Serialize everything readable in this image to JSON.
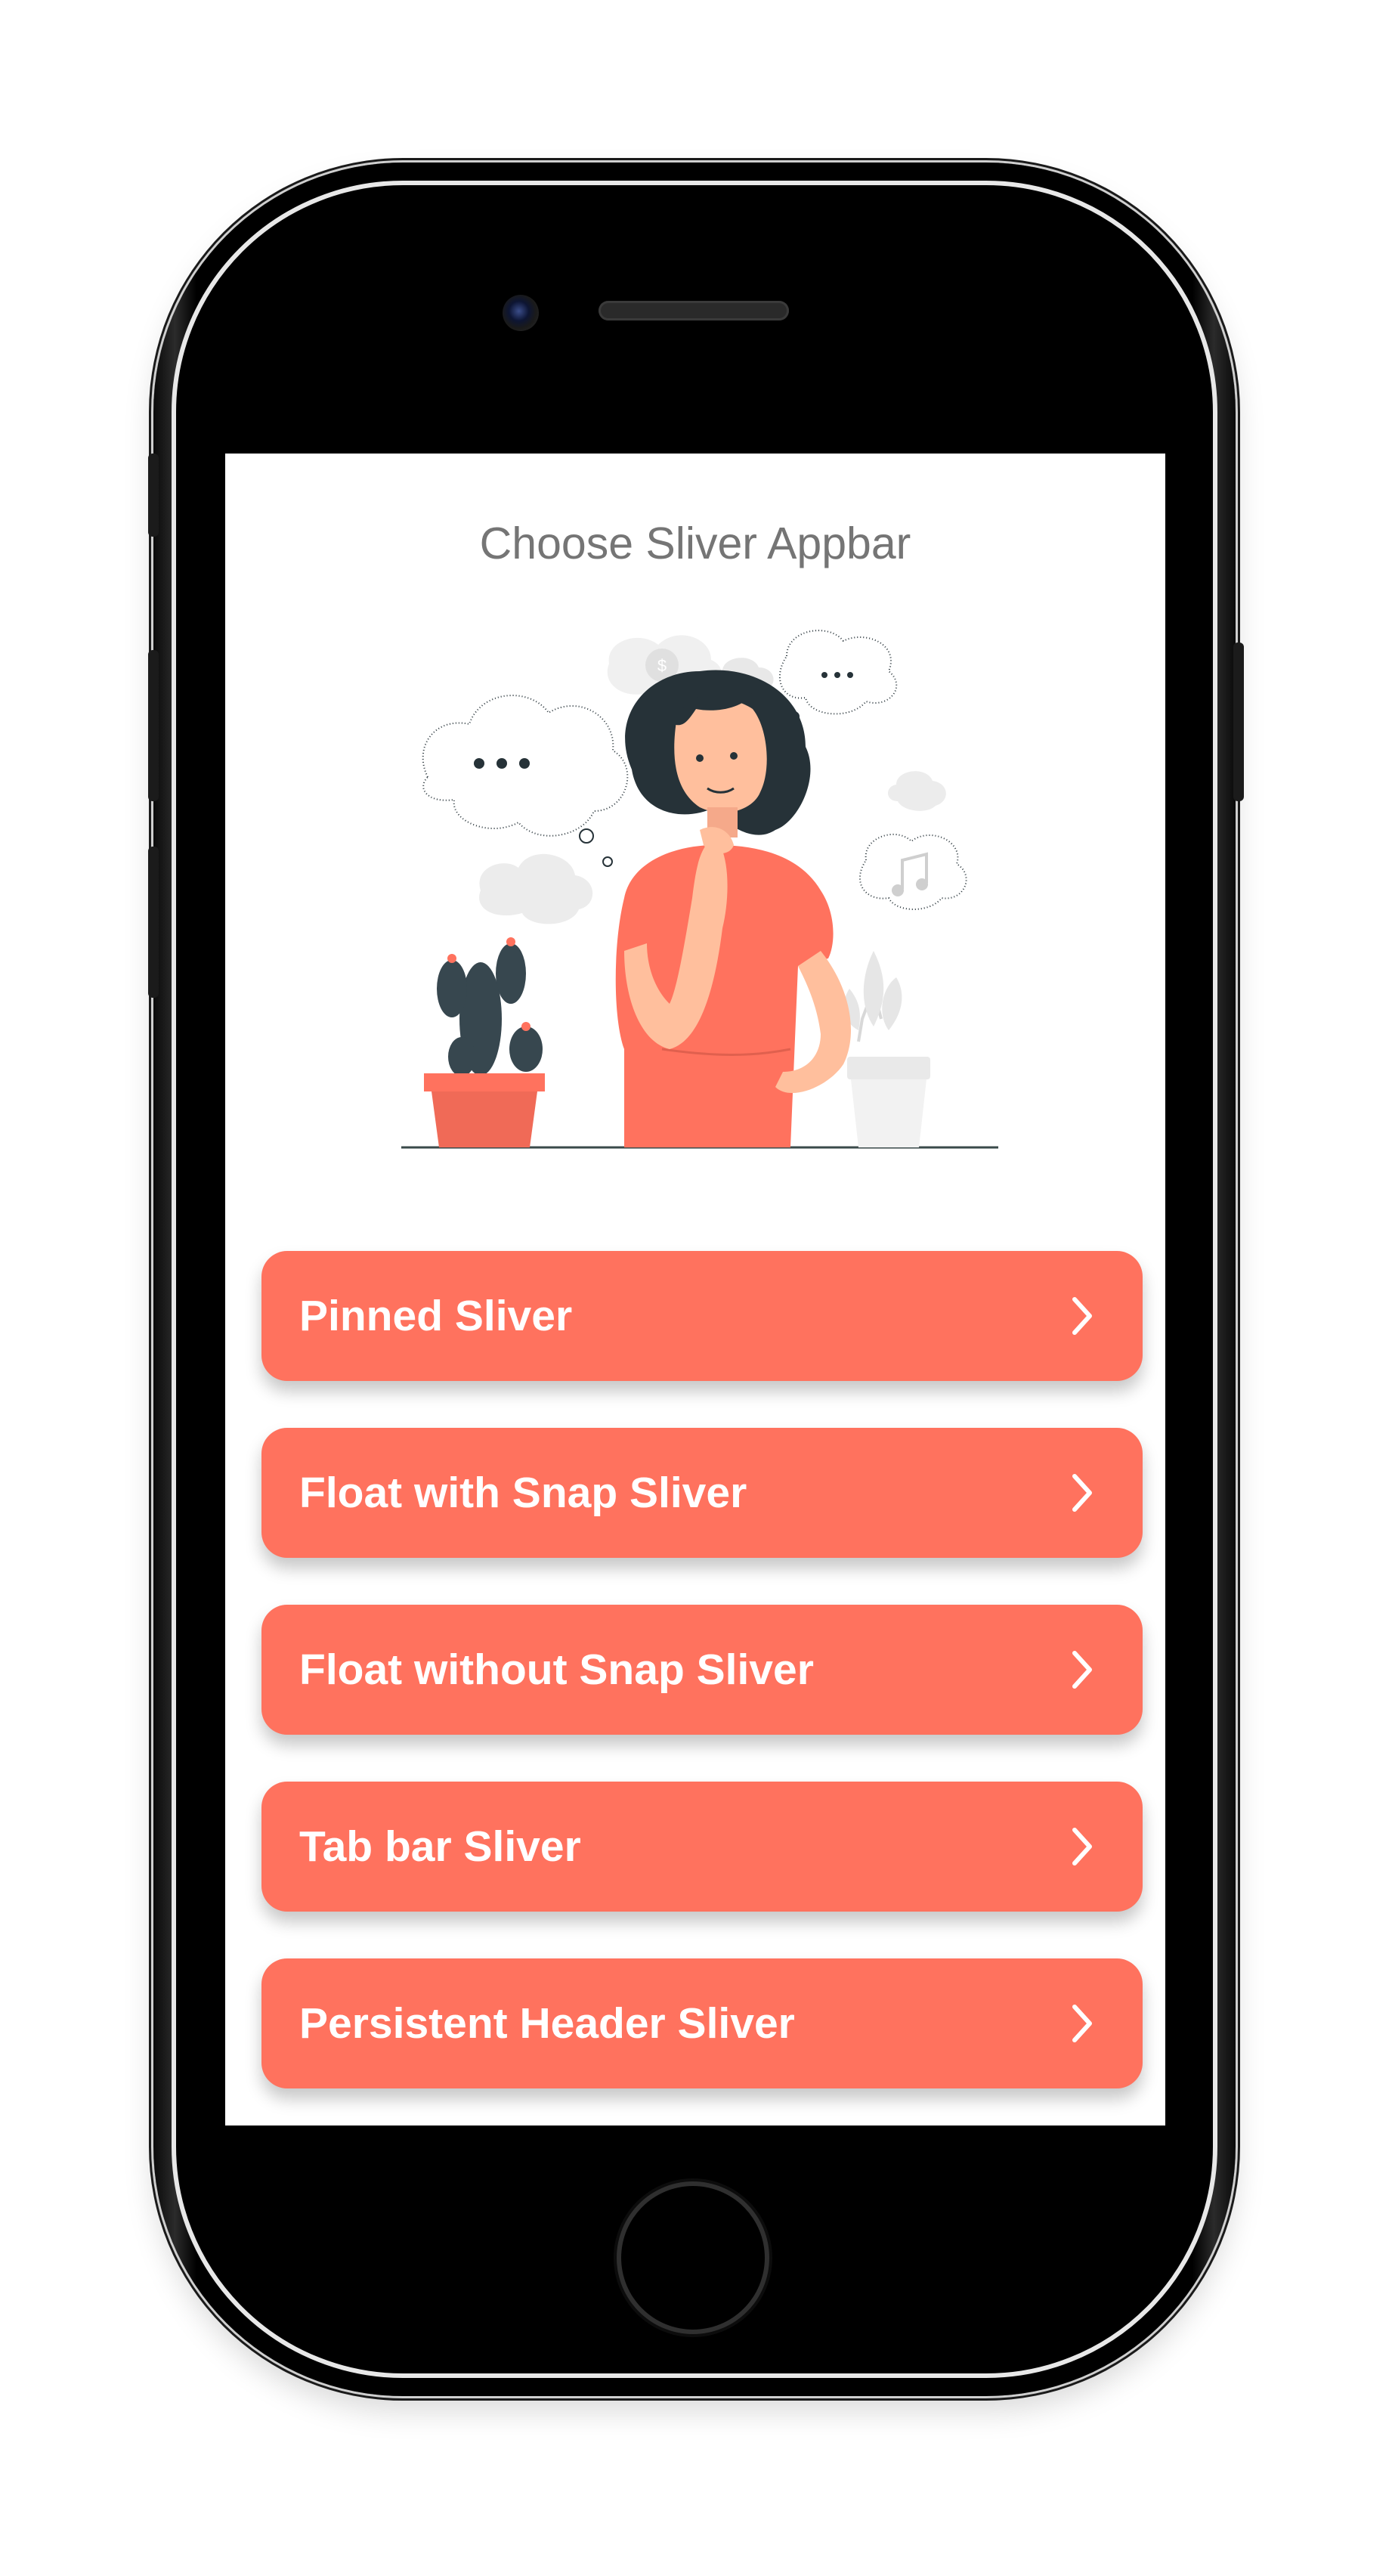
{
  "screen": {
    "title": "Choose Sliver Appbar"
  },
  "menu": {
    "items": [
      {
        "label": "Pinned Sliver",
        "icon": "chevron-right-icon"
      },
      {
        "label": "Float with Snap Sliver",
        "icon": "chevron-right-icon"
      },
      {
        "label": "Float without Snap Sliver",
        "icon": "chevron-right-icon"
      },
      {
        "label": "Tab bar Sliver",
        "icon": "chevron-right-icon"
      },
      {
        "label": "Persistent Header Sliver",
        "icon": "chevron-right-icon"
      }
    ]
  },
  "colors": {
    "accent": "#ff725e",
    "title_text": "#757575",
    "button_text": "#ffffff",
    "device_frame": "#000000"
  },
  "illustration": {
    "description_icon": "thinking-woman-illustration"
  }
}
